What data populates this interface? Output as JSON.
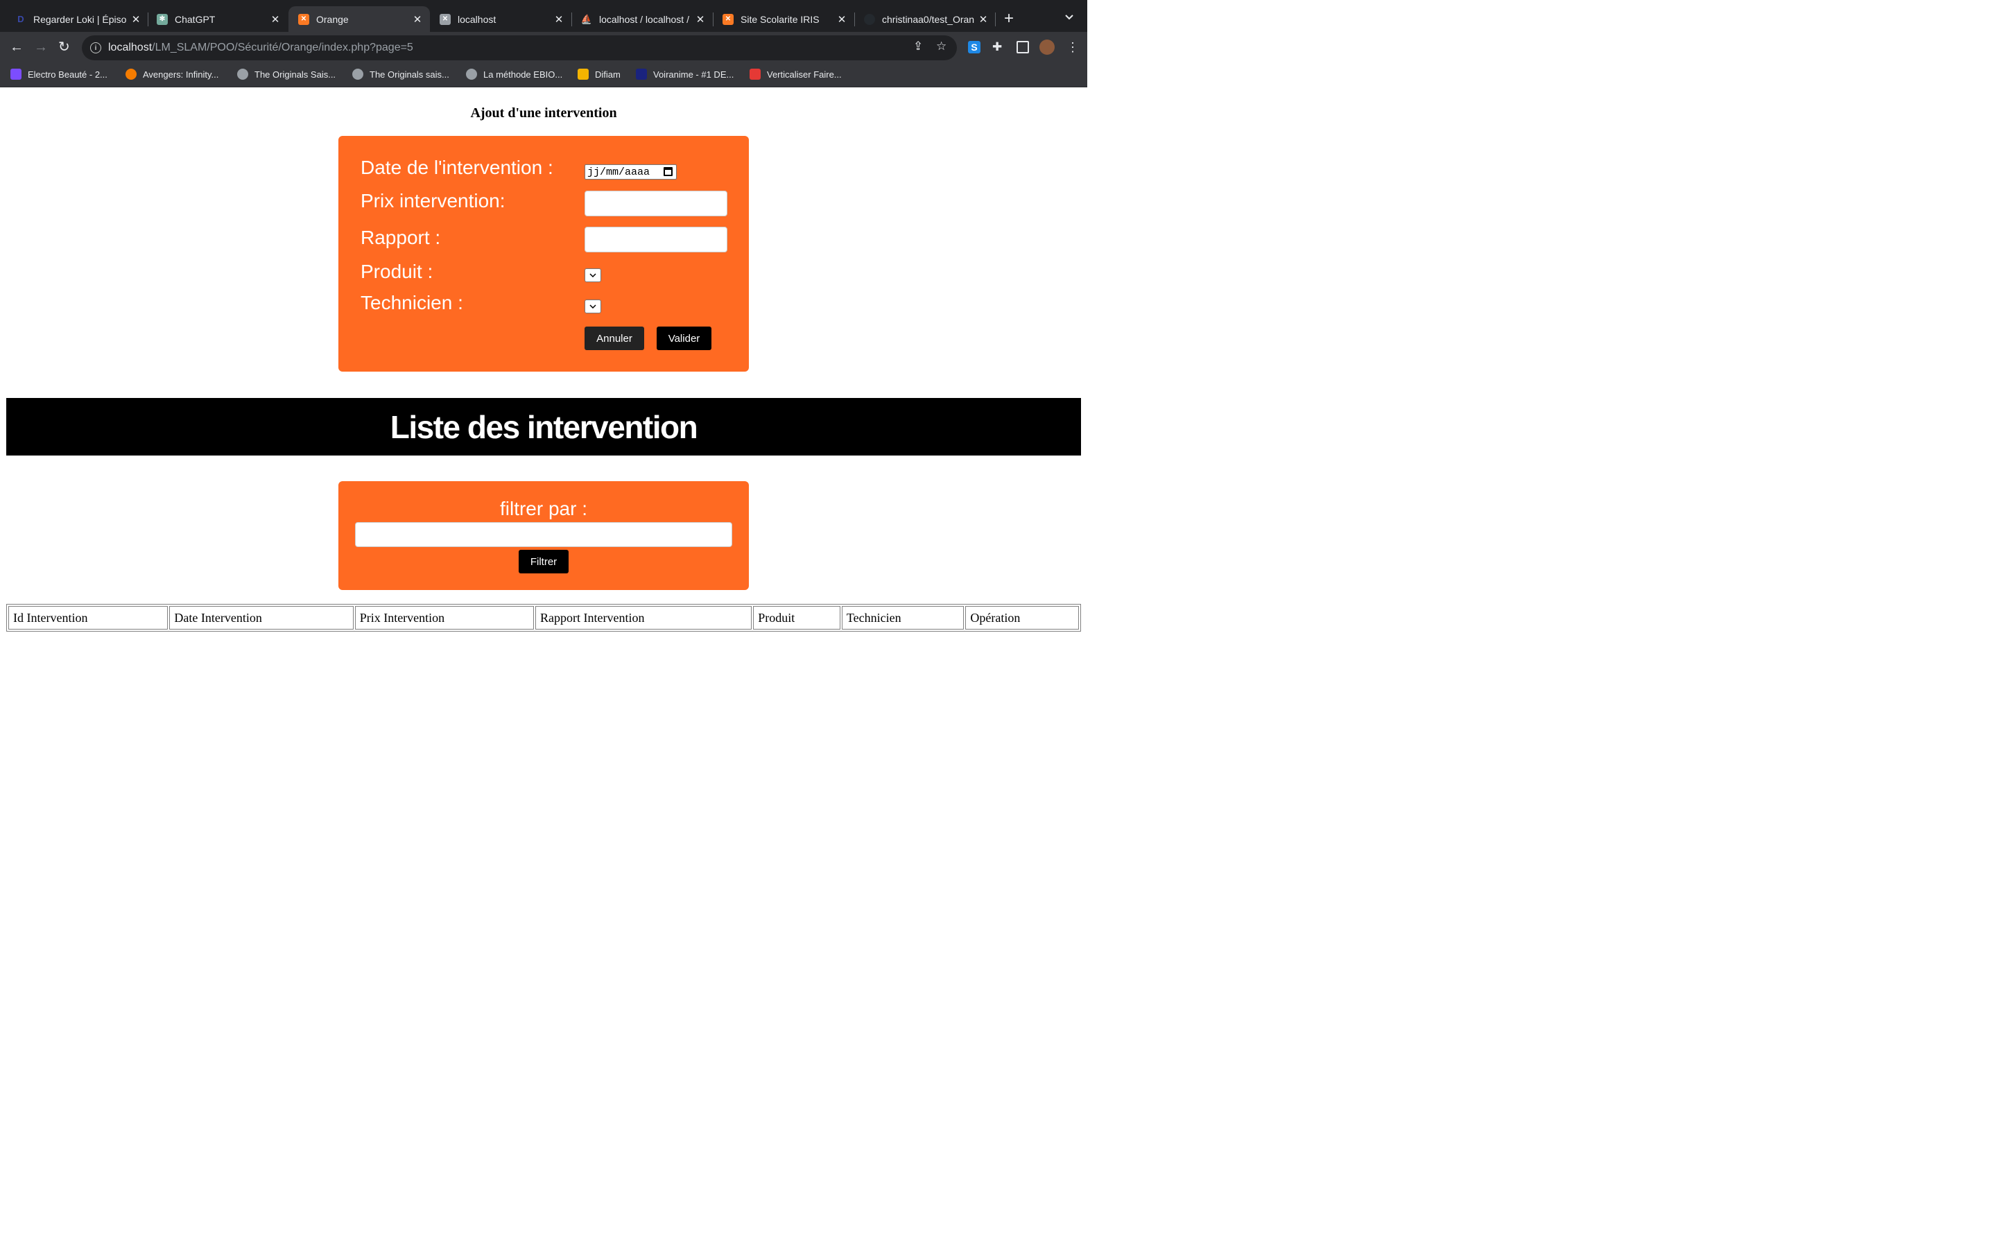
{
  "browser": {
    "tabs": [
      {
        "title": "Regarder Loki | Épiso",
        "favicon_color": "#1a1aa8",
        "active": false
      },
      {
        "title": "ChatGPT",
        "favicon_color": "#74aa9c",
        "active": false
      },
      {
        "title": "Orange",
        "favicon_color": "#fb7a24",
        "active": true
      },
      {
        "title": "localhost",
        "favicon_color": "#9aa0a6",
        "active": false
      },
      {
        "title": "localhost / localhost /",
        "favicon_color": "#f89c0e",
        "active": false
      },
      {
        "title": "Site Scolarite IRIS",
        "favicon_color": "#fb7a24",
        "active": false
      },
      {
        "title": "christinaa0/test_Oran",
        "favicon_color": "#24292e",
        "active": false
      }
    ],
    "url_host": "localhost",
    "url_path": "/LM_SLAM/POO/Sécurité/Orange/index.php?page=5",
    "bookmarks": [
      {
        "label": "Electro Beauté - 2...",
        "color": "#7c4dff"
      },
      {
        "label": "Avengers: Infinity...",
        "color": "#f57c00"
      },
      {
        "label": "The Originals Sais...",
        "color": "#9aa0a6"
      },
      {
        "label": "The Originals sais...",
        "color": "#9aa0a6"
      },
      {
        "label": "La méthode EBIO...",
        "color": "#9aa0a6"
      },
      {
        "label": "Difiam",
        "color": "#f4b400"
      },
      {
        "label": "Voiranime - #1 DE...",
        "color": "#1a237e"
      },
      {
        "label": "Verticaliser Faire...",
        "color": "#e53935"
      }
    ]
  },
  "form": {
    "heading": "Ajout d'une intervention",
    "date_label": "Date de l'intervention :",
    "date_placeholder": "jj/mm/aaaa",
    "prix_label": "Prix intervention:",
    "rapport_label": "Rapport :",
    "produit_label": "Produit :",
    "technicien_label": "Technicien :",
    "cancel_label": "Annuler",
    "submit_label": "Valider"
  },
  "list": {
    "banner_title": "Liste des intervention",
    "filter_label": "filtrer par :",
    "filter_button": "Filtrer",
    "columns": [
      "Id Intervention",
      "Date Intervention",
      "Prix Intervention",
      "Rapport Intervention",
      "Produit",
      "Technicien",
      "Opération"
    ]
  },
  "colors": {
    "card_orange": "#ff6a22",
    "banner_black": "#000000"
  }
}
